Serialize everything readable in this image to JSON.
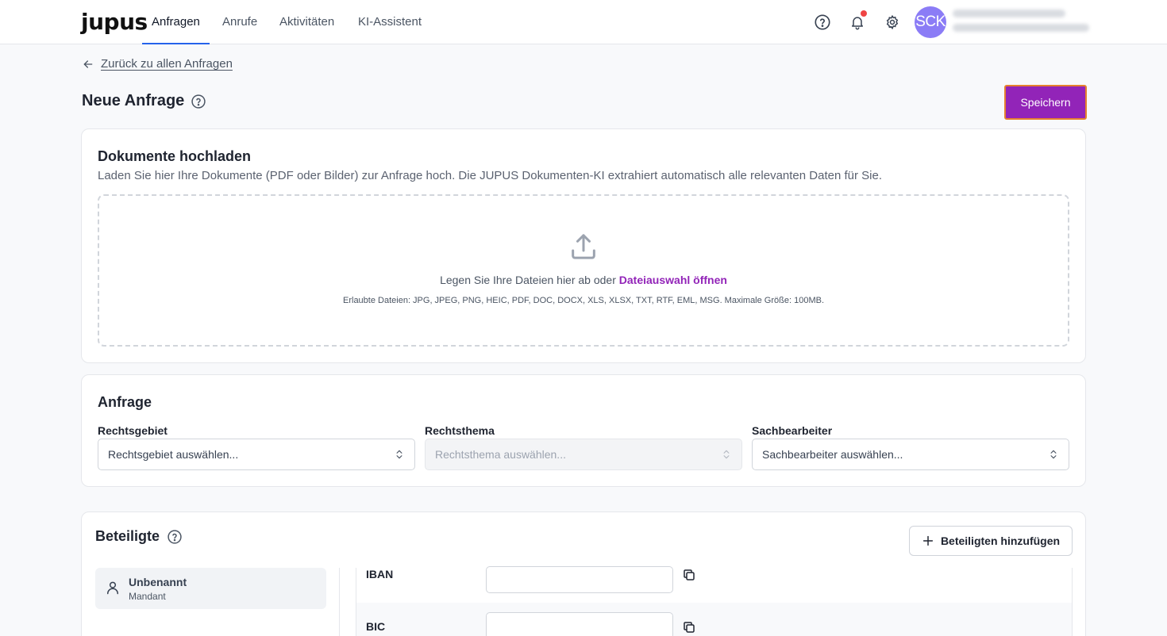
{
  "app": {
    "logo": "jupus"
  },
  "nav": {
    "tabs": [
      {
        "label": "Anfragen",
        "active": true
      },
      {
        "label": "Anrufe"
      },
      {
        "label": "Aktivitäten"
      },
      {
        "label": "KI-Assistent"
      }
    ]
  },
  "user": {
    "initials": "SCK"
  },
  "header": {
    "back_label": "Zurück zu allen Anfragen",
    "title": "Neue Anfrage",
    "save_label": "Speichern"
  },
  "upload": {
    "title": "Dokumente hochladen",
    "description": "Laden Sie hier Ihre Dokumente (PDF oder Bilder) zur Anfrage hoch. Die JUPUS Dokumenten-KI extrahiert automatisch alle relevanten Daten für Sie.",
    "drop_text": "Legen Sie Ihre Dateien hier ab oder",
    "drop_link": "Dateiauswahl öffnen",
    "allowed": "Erlaubte Dateien: JPG, JPEG, PNG, HEIC, PDF, DOC, DOCX, XLS, XLSX, TXT, RTF, EML, MSG. Maximale Größe: 100MB."
  },
  "anfrage": {
    "title": "Anfrage",
    "fields": [
      {
        "label": "Rechtsgebiet",
        "placeholder": "Rechtsgebiet auswählen..."
      },
      {
        "label": "Rechtsthema",
        "placeholder": "Rechtsthema auswählen...",
        "disabled": true
      },
      {
        "label": "Sachbearbeiter",
        "placeholder": "Sachbearbeiter auswählen..."
      }
    ]
  },
  "beteiligte": {
    "title": "Beteiligte",
    "add_label": "Beteiligten hinzufügen",
    "people": [
      {
        "name": "Unbenannt",
        "role": "Mandant"
      }
    ],
    "fields": [
      {
        "label": "IBAN",
        "value": ""
      },
      {
        "label": "BIC",
        "value": ""
      }
    ]
  },
  "colors": {
    "accent": "#9224b8",
    "nav_active": "#2563eb",
    "avatar": "#8b7cf6",
    "notification": "#ef4444"
  },
  "icons": [
    "back-arrow-icon",
    "help-icon",
    "bell-icon",
    "gear-icon",
    "upload-icon",
    "chevron-updown-icon",
    "plus-icon",
    "user-icon",
    "copy-icon"
  ]
}
